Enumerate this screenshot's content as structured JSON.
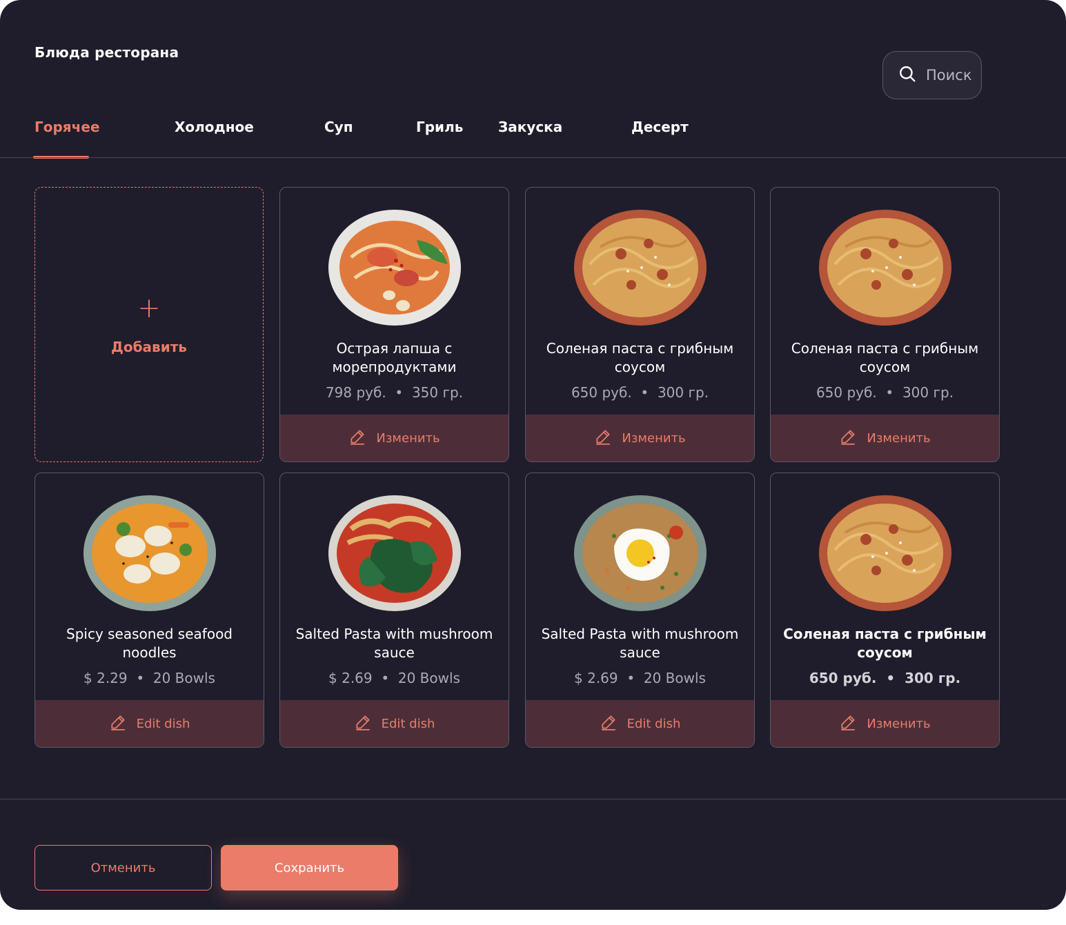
{
  "page": {
    "title": "Блюда ресторана"
  },
  "search": {
    "placeholder": "Поиск",
    "icon": "search-icon"
  },
  "tabs": [
    {
      "label": "Горячее",
      "active": true
    },
    {
      "label": "Холодное",
      "active": false
    },
    {
      "label": "Суп",
      "active": false
    },
    {
      "label": "Гриль",
      "active": false
    },
    {
      "label": "Закуска",
      "active": false
    },
    {
      "label": "Десерт",
      "active": false
    }
  ],
  "add_card": {
    "label": "Добавить",
    "icon": "plus-icon"
  },
  "dishes": [
    {
      "name": "Острая лапша с морепродуктами",
      "price": "798 руб.",
      "amount": "350 гр.",
      "edit_label": "Изменить",
      "image": "seafood-noodle-bowl"
    },
    {
      "name": "Соленая паста с грибным соусом",
      "price": "650 руб.",
      "amount": "300 гр.",
      "edit_label": "Изменить",
      "image": "spaghetti-bowl"
    },
    {
      "name": "Соленая паста с грибным соусом",
      "price": "650 руб.",
      "amount": "300 гр.",
      "edit_label": "Изменить",
      "image": "spaghetti-bowl"
    },
    {
      "name": "Spicy seasoned seafood noodles",
      "price": "$ 2.29",
      "amount": "20 Bowls",
      "edit_label": "Edit dish",
      "image": "dumpling-curry-bowl"
    },
    {
      "name": "Salted Pasta with mushroom sauce",
      "price": "$ 2.69",
      "amount": "20 Bowls",
      "edit_label": "Edit dish",
      "image": "ramen-greens-bowl"
    },
    {
      "name": "Salted Pasta with mushroom sauce",
      "price": "$ 2.69",
      "amount": "20 Bowls",
      "edit_label": "Edit dish",
      "image": "fried-rice-egg-bowl"
    },
    {
      "name": "Соленая паста с грибным соусом",
      "price": "650 руб.",
      "amount": "300 гр.",
      "edit_label": "Изменить",
      "image": "spaghetti-bowl"
    }
  ],
  "footer": {
    "cancel_label": "Отменить",
    "save_label": "Сохранить"
  },
  "colors": {
    "background": "#1f1d2b",
    "accent": "#ea7c69",
    "edit_bar": "#4d2e38",
    "border": "#5a5868"
  }
}
